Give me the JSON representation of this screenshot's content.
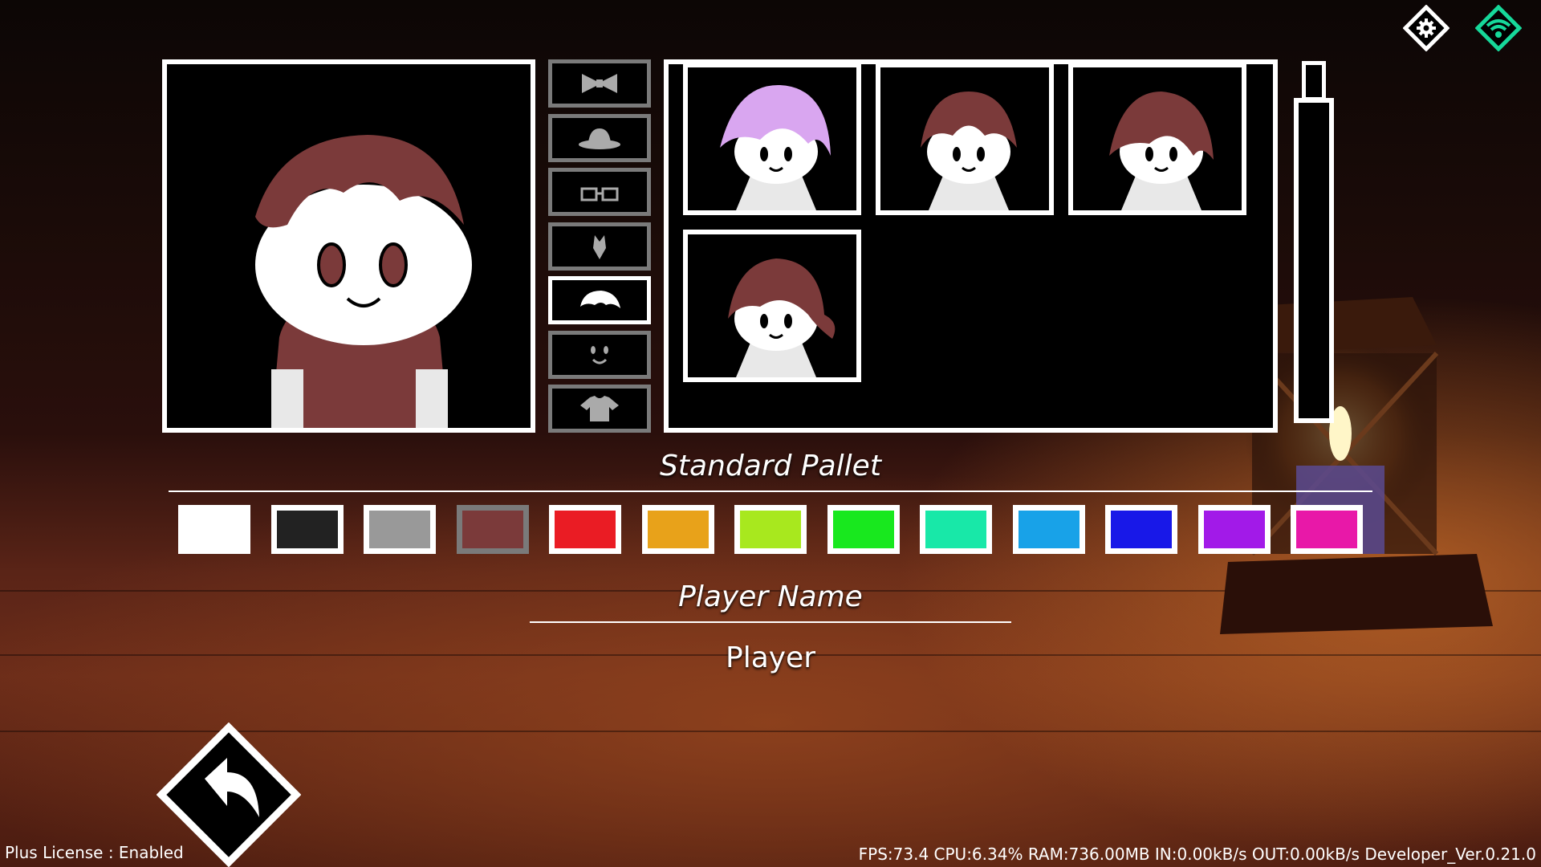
{
  "palette_heading": "Standard Pallet",
  "name_heading": "Player Name",
  "player_name": "Player",
  "categories": [
    {
      "icon": "bow-icon",
      "active": false
    },
    {
      "icon": "hat-icon",
      "active": false
    },
    {
      "icon": "glasses-icon",
      "active": false
    },
    {
      "icon": "mouth-accessory-icon",
      "active": false
    },
    {
      "icon": "hair-icon",
      "active": true
    },
    {
      "icon": "face-icon",
      "active": false
    },
    {
      "icon": "shirt-icon",
      "active": false
    }
  ],
  "hair_options": [
    {
      "name": "hair-option-lavender",
      "color": "#d9a6f0"
    },
    {
      "name": "hair-option-short",
      "color": "#7b3a3a"
    },
    {
      "name": "hair-option-messy",
      "color": "#7b3a3a"
    },
    {
      "name": "hair-option-ponytail",
      "color": "#7b3a3a"
    }
  ],
  "colors": [
    "#ffffff",
    "#222222",
    "#999999",
    "#7b3a3a",
    "#ea1c24",
    "#e8a21a",
    "#a8e81e",
    "#18e81e",
    "#18e8a8",
    "#18a2e8",
    "#1818e8",
    "#a21ae8",
    "#e818a8"
  ],
  "selected_color": "#7b3a3a",
  "status": {
    "license": "Plus License : Enabled",
    "stats": "FPS:73.4  CPU:6.34%  RAM:736.00MB  IN:0.00kB/s  OUT:0.00kB/s    Developer_Ver.0.21.0"
  }
}
